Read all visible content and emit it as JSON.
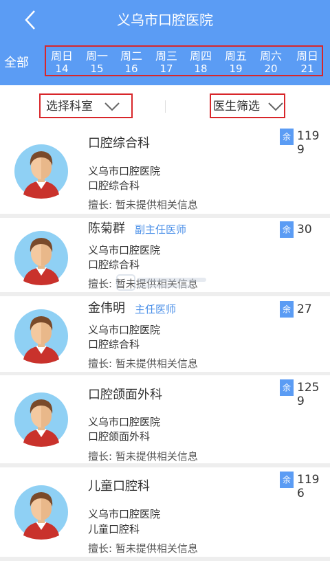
{
  "header": {
    "title": "义乌市口腔医院",
    "all_label": "全部",
    "days": [
      {
        "weekday": "周日",
        "date": "14"
      },
      {
        "weekday": "周一",
        "date": "15"
      },
      {
        "weekday": "周二",
        "date": "16"
      },
      {
        "weekday": "周三",
        "date": "17"
      },
      {
        "weekday": "周四",
        "date": "18"
      },
      {
        "weekday": "周五",
        "date": "19"
      },
      {
        "weekday": "周六",
        "date": "20"
      },
      {
        "weekday": "周日",
        "date": "21"
      }
    ]
  },
  "filters": {
    "department": "选择科室",
    "doctor": "医生筛选"
  },
  "list": [
    {
      "name": "口腔综合科",
      "title": "",
      "hospital": "义乌市口腔医院",
      "department": "口腔综合科",
      "specialty": "擅长:  暂未提供相关信息",
      "remaining_label": "余",
      "remaining": "1199"
    },
    {
      "name": "陈菊群",
      "title": "副主任医师",
      "hospital": "义乌市口腔医院",
      "department": "口腔综合科",
      "specialty": "擅长:  暂未提供相关信息",
      "remaining_label": "余",
      "remaining": "30"
    },
    {
      "name": "金伟明",
      "title": "主任医师",
      "hospital": "义乌市口腔医院",
      "department": "口腔综合科",
      "specialty": "擅长:  暂未提供相关信息",
      "remaining_label": "余",
      "remaining": "27"
    },
    {
      "name": "口腔颌面外科",
      "title": "",
      "hospital": "义乌市口腔医院",
      "department": "口腔颌面外科",
      "specialty": "擅长:  暂未提供相关信息",
      "remaining_label": "余",
      "remaining": "1259"
    },
    {
      "name": "儿童口腔科",
      "title": "",
      "hospital": "义乌市口腔医院",
      "department": "儿童口腔科",
      "specialty": "擅长:  暂未提供相关信息",
      "remaining_label": "余",
      "remaining": "1196"
    }
  ],
  "colors": {
    "header_bg": "#5b9cf4",
    "highlight_border": "#d8262a",
    "title_blue": "#4a8fe8"
  },
  "icons": {
    "back": "chevron-left-icon",
    "dropdown": "chevron-down-icon",
    "avatar": "doctor-avatar-icon"
  }
}
